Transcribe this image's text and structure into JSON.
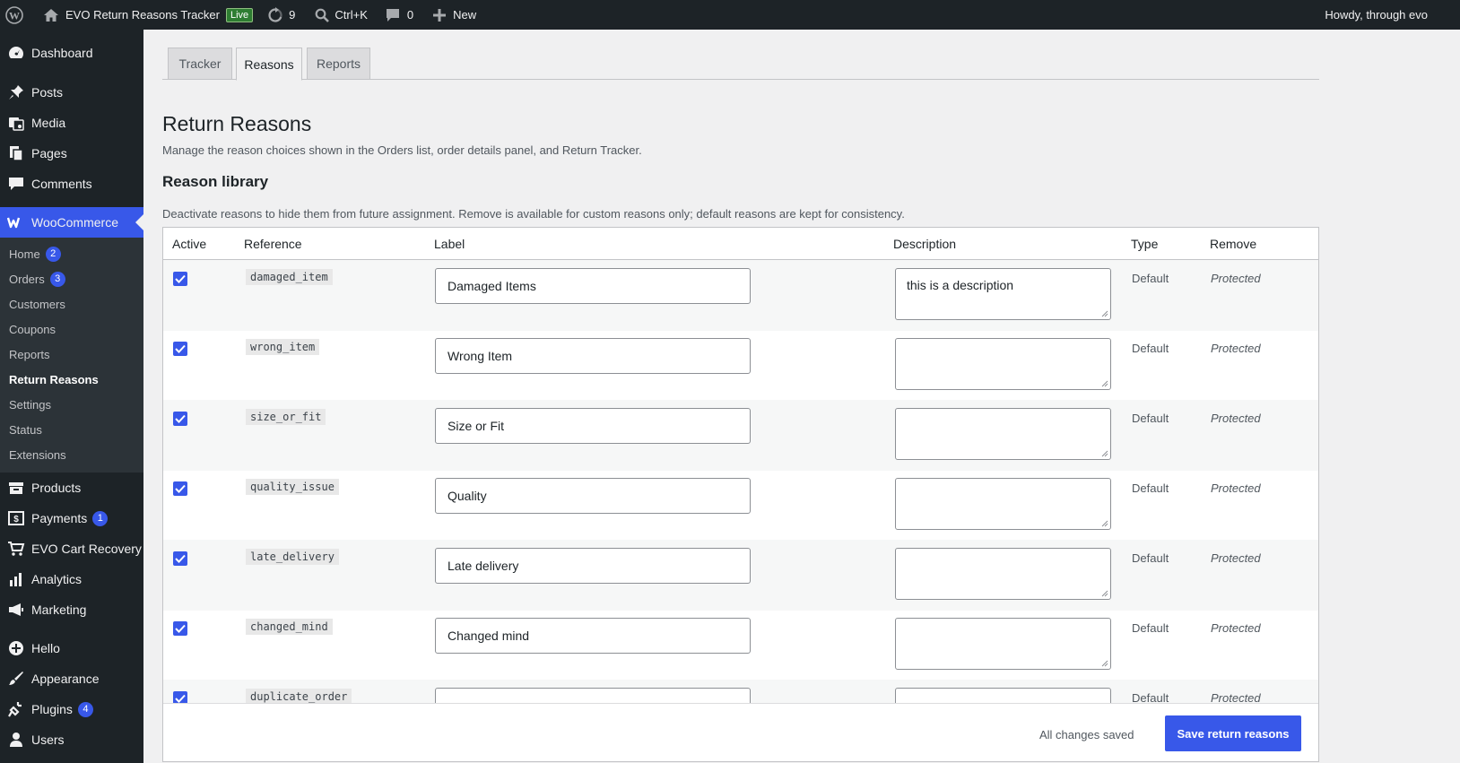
{
  "adminbar": {
    "site_name": "EVO Return Reasons Tracker",
    "live_badge": "Live",
    "updates_count": "9",
    "search_shortcut": "Ctrl+K",
    "comments_count": "0",
    "new_label": "New",
    "howdy": "Howdy, through evo"
  },
  "sidebar": {
    "dashboard": "Dashboard",
    "posts": "Posts",
    "media": "Media",
    "pages": "Pages",
    "comments": "Comments",
    "woocommerce": "WooCommerce",
    "woo_sub": [
      {
        "label": "Home",
        "badge": "2"
      },
      {
        "label": "Orders",
        "badge": "3"
      },
      {
        "label": "Customers"
      },
      {
        "label": "Coupons"
      },
      {
        "label": "Reports"
      },
      {
        "label": "Return Reasons"
      },
      {
        "label": "Settings"
      },
      {
        "label": "Status"
      },
      {
        "label": "Extensions"
      }
    ],
    "products": "Products",
    "payments": "Payments",
    "payments_badge": "1",
    "evo_cart": "EVO Cart Recovery",
    "analytics": "Analytics",
    "marketing": "Marketing",
    "hello": "Hello",
    "appearance": "Appearance",
    "plugins": "Plugins",
    "plugins_badge": "4",
    "users": "Users"
  },
  "tabs": [
    "Tracker",
    "Reasons",
    "Reports"
  ],
  "page": {
    "title": "Return Reasons",
    "description": "Manage the reason choices shown in the Orders list, order details panel, and Return Tracker.",
    "section_title": "Reason library",
    "section_description": "Deactivate reasons to hide them from future assignment. Remove is available for custom reasons only; default reasons are kept for consistency."
  },
  "table": {
    "headers": [
      "Active",
      "Reference",
      "Label",
      "Description",
      "Type",
      "Remove"
    ],
    "rows": [
      {
        "ref": "damaged_item",
        "label": "Damaged Items",
        "description": "this is a description",
        "type": "Default",
        "remove": "Protected"
      },
      {
        "ref": "wrong_item",
        "label": "Wrong Item",
        "description": "",
        "type": "Default",
        "remove": "Protected"
      },
      {
        "ref": "size_or_fit",
        "label": "Size or Fit",
        "description": "",
        "type": "Default",
        "remove": "Protected"
      },
      {
        "ref": "quality_issue",
        "label": "Quality",
        "description": "",
        "type": "Default",
        "remove": "Protected"
      },
      {
        "ref": "late_delivery",
        "label": "Late delivery",
        "description": "",
        "type": "Default",
        "remove": "Protected"
      },
      {
        "ref": "changed_mind",
        "label": "Changed mind",
        "description": "",
        "type": "Default",
        "remove": "Protected"
      },
      {
        "ref": "duplicate_order",
        "label": "",
        "description": "",
        "type": "Default",
        "remove": "Protected"
      }
    ]
  },
  "footer": {
    "status": "All changes saved",
    "save_label": "Save return reasons"
  },
  "colors": {
    "accent": "#3858e9",
    "adminbar": "#1d2327",
    "current_menu": "#2271b1"
  }
}
